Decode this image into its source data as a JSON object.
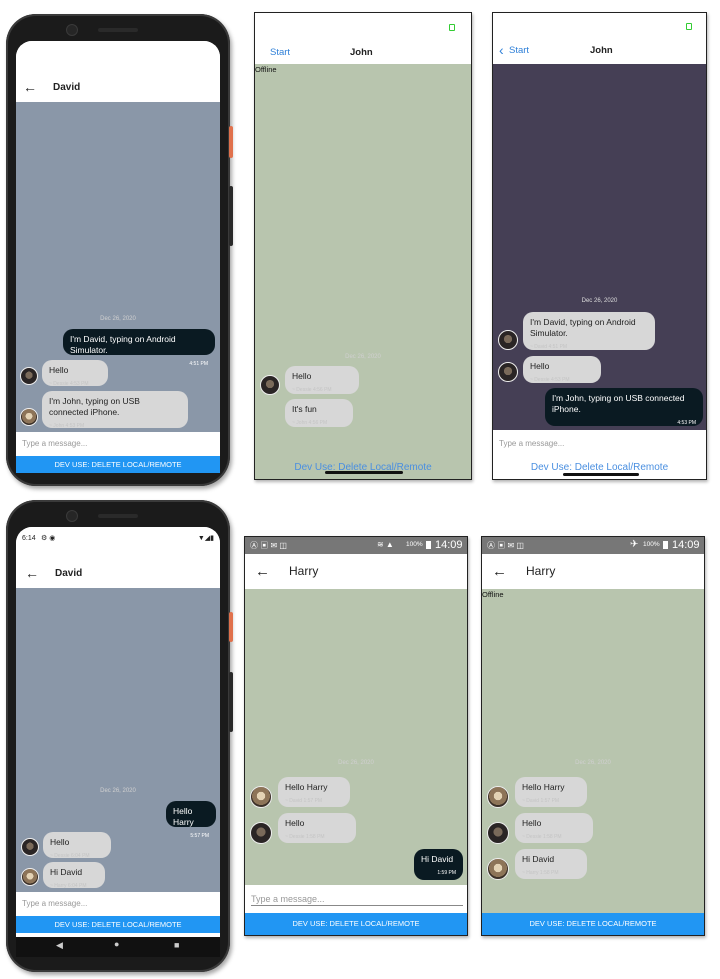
{
  "p1": {
    "title": "David",
    "date": "Dec 26, 2020",
    "msg1": "I'm David, typing on Android Simulator.",
    "msg1_time": "4:51 PM",
    "msg2": "Hello",
    "msg2_meta": "~ Dessie     4:53 PM",
    "msg3": "I'm John, typing on USB connected iPhone.",
    "msg3_meta": "~ John     4:53 PM",
    "placeholder": "Type a message...",
    "dev": "DEV USE: DELETE LOCAL/REMOTE"
  },
  "p2": {
    "back": "Start",
    "title": "John",
    "offline": "Offline",
    "date": "Dec 26, 2020",
    "msg1": "Hello",
    "msg1_meta": "~ Dessie     4:56 PM",
    "msg2": "It's fun",
    "msg2_meta": "~ John     4:56 PM",
    "dev": "Dev Use: Delete Local/Remote"
  },
  "p3": {
    "back": "Start",
    "title": "John",
    "date": "Dec 26, 2020",
    "msg1": "I'm David, typing on Android Simulator.",
    "msg1_meta": "~ David     4:51 PM",
    "msg2": "Hello",
    "msg2_meta": "~ Dessie     4:53 PM",
    "msg3": "I'm John, typing on USB connected iPhone.",
    "msg3_time": "4:53 PM",
    "placeholder": "Type a message...",
    "dev": "Dev Use: Delete Local/Remote"
  },
  "p4": {
    "status_time": "6:14",
    "title": "David",
    "date": "Dec 26, 2020",
    "msg1": "Hello Harry",
    "msg1_time": "5:57 PM",
    "msg2": "Hello",
    "msg2_meta": "~ Dessie     6:04 PM",
    "msg3": "Hi David",
    "msg3_meta": "~ Harry     6:04 PM",
    "placeholder": "Type a message...",
    "dev": "DEV USE: DELETE LOCAL/REMOTE"
  },
  "p5": {
    "battery": "100%",
    "status_time": "14:09",
    "title": "Harry",
    "date": "Dec 26, 2020",
    "msg1": "Hello Harry",
    "msg1_meta": "~ David     1:57 PM",
    "msg2": "Hello",
    "msg2_meta": "~ Dessie     1:58 PM",
    "msg3": "Hi David",
    "msg3_time": "1:59 PM",
    "placeholder": "Type a message...",
    "dev": "DEV USE: DELETE LOCAL/REMOTE"
  },
  "p6": {
    "battery": "100%",
    "status_time": "14:09",
    "title": "Harry",
    "offline": "Offline",
    "date": "Dec 26, 2020",
    "msg1": "Hello Harry",
    "msg1_meta": "~ David     1:57 PM",
    "msg2": "Hello",
    "msg2_meta": "~ Dessie     1:58 PM",
    "msg3": "Hi David",
    "msg3_meta": "~ Harry     1:58 PM",
    "dev": "DEV USE: DELETE LOCAL/REMOTE"
  },
  "colors": {
    "chat_grey": "#8a97a8",
    "chat_green": "#b8c5ae",
    "chat_dark": "#453f55",
    "bubble_dark": "#0a1a22",
    "bubble_light": "#d7d7d7",
    "dev_blue": "#2196f3",
    "ios_link": "#2f80d8"
  },
  "icons": [
    "back-arrow-icon",
    "chevron-left-icon",
    "avatar-icon",
    "battery-icon",
    "wifi-icon",
    "airplane-icon",
    "nav-back-icon",
    "nav-home-icon",
    "nav-recent-icon"
  ]
}
